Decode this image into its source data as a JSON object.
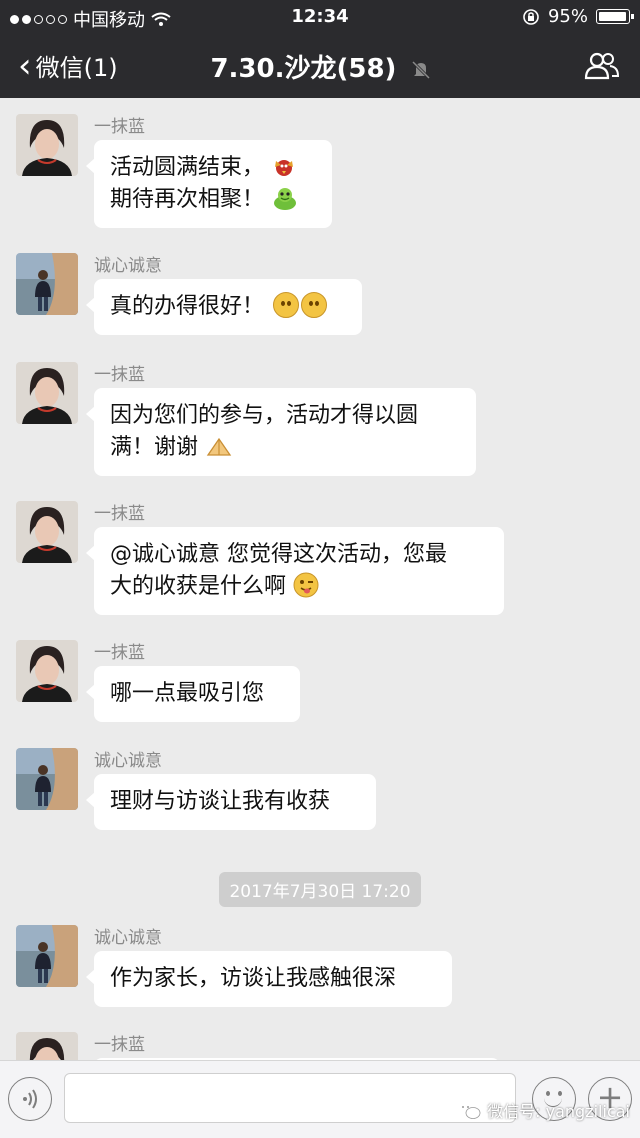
{
  "status_bar": {
    "carrier": "中国移动",
    "time": "12:34",
    "battery": "95%",
    "battery_level": 0.95,
    "signal_bars_filled": 2,
    "signal_bars_total": 5
  },
  "nav": {
    "back_label": "微信(1)",
    "title": "7.30.沙龙(58)",
    "icons": [
      "chevron-left-icon",
      "mute-bell-icon",
      "group-members-icon"
    ]
  },
  "messages": [
    {
      "sender": "一抹蓝",
      "lines": [
        "活动圆满结束，",
        "期待再次相聚！"
      ],
      "stickers": [
        "bird-sticker-icon",
        "frog-sticker-icon"
      ]
    },
    {
      "sender": "诚心诚意",
      "text": "真的办得很好！",
      "emojis": [
        "smile-emoji-icon",
        "smile-emoji-icon"
      ]
    },
    {
      "sender": "一抹蓝",
      "lines": [
        "因为您们的参与，活动才得以圆",
        "满！谢谢"
      ],
      "emojis": [
        "praying-hands-emoji-icon"
      ]
    },
    {
      "sender": "一抹蓝",
      "lines": [
        "@诚心诚意 您觉得这次活动，您最",
        "大的收获是什么啊"
      ],
      "emojis": [
        "wink-tongue-emoji-icon"
      ]
    },
    {
      "sender": "一抹蓝",
      "text": "哪一点最吸引您"
    },
    {
      "sender": "诚心诚意",
      "text": "理财与访谈让我有收获"
    },
    {
      "sender": "诚心诚意",
      "text": "作为家长，访谈让我感触很深"
    },
    {
      "sender": "一抹蓝",
      "text": ""
    }
  ],
  "timestamp": "2017年7月30日 17:20",
  "input_bar": {
    "value": "",
    "placeholder": ""
  },
  "watermark": "微信号: yangzilicai",
  "colors": {
    "bar_bg": "#2b2b2e",
    "chat_bg": "#ebebeb",
    "bubble_bg": "#ffffff",
    "sender_text": "#8a8a8a"
  }
}
